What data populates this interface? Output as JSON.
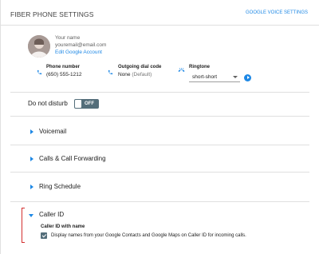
{
  "header": {
    "title": "FIBER PHONE SETTINGS",
    "link": "GOOGLE VOICE SETTINGS"
  },
  "account": {
    "name": "Your name",
    "email": "youremail@email.com",
    "edit_label": "Edit Google Account"
  },
  "fields": {
    "phone_number": {
      "label": "Phone number",
      "value": "(650) 555-1212",
      "icon": "phone-icon"
    },
    "outgoing": {
      "label": "Outgoing dial code",
      "value": "None",
      "value_note": "(Default)",
      "icon": "phone-icon"
    },
    "ringtone": {
      "label": "Ringtone",
      "selected": "short-short",
      "icon": "ringtone-icon"
    }
  },
  "dnd": {
    "label": "Do not disturb",
    "state": "OFF"
  },
  "sections": [
    {
      "label": "Voicemail",
      "expanded": false
    },
    {
      "label": "Calls & Call Forwarding",
      "expanded": false
    },
    {
      "label": "Ring Schedule",
      "expanded": false
    },
    {
      "label": "Caller ID",
      "expanded": true
    }
  ],
  "caller_id": {
    "heading": "Caller ID with name",
    "checked": true,
    "description": "Display names from your Google Contacts and Google Maps on Caller ID for incoming calls."
  },
  "colors": {
    "accent": "#1e88e5",
    "toggle": "#546e7a",
    "highlight": "#d32f2f",
    "divider": "#e0e0e0"
  }
}
